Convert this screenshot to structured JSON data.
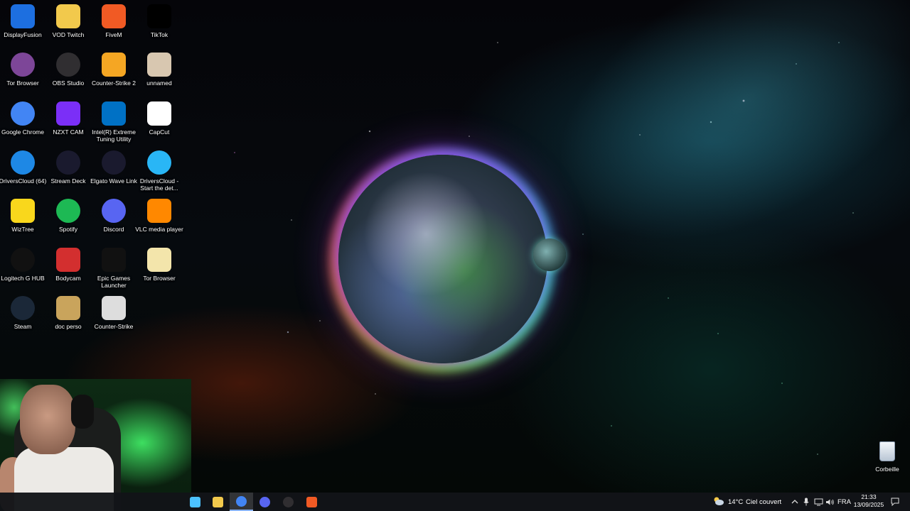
{
  "desktop": {
    "icons": [
      {
        "label": "DisplayFusion",
        "icon": "displayfusion-icon",
        "color": "#1d6fe0"
      },
      {
        "label": "VOD Twitch",
        "icon": "folder-icon",
        "color": "#f2c94c"
      },
      {
        "label": "FiveM",
        "icon": "fivem-icon",
        "color": "#f15a24"
      },
      {
        "label": "TikTok",
        "icon": "tiktok-icon",
        "color": "#000000"
      },
      {
        "label": "Tor Browser",
        "icon": "tor-browser-icon",
        "color": "#7d4698"
      },
      {
        "label": "OBS Studio",
        "icon": "obs-icon",
        "color": "#302e31"
      },
      {
        "label": "Counter-Strike 2",
        "icon": "counter-strike-2-icon",
        "color": "#f5a623"
      },
      {
        "label": "unnamed",
        "icon": "image-file-icon",
        "color": "#d8c7b0"
      },
      {
        "label": "Google Chrome",
        "icon": "chrome-icon",
        "color": "#4285f4"
      },
      {
        "label": "NZXT CAM",
        "icon": "nzxt-cam-icon",
        "color": "#7b2ff7"
      },
      {
        "label": "Intel(R) Extreme Tuning Utility",
        "icon": "intel-xtu-icon",
        "color": "#0071c5"
      },
      {
        "label": "CapCut",
        "icon": "capcut-icon",
        "color": "#ffffff"
      },
      {
        "label": "DriversCloud (64)",
        "icon": "driverscloud-icon",
        "color": "#1e88e5"
      },
      {
        "label": "Stream Deck",
        "icon": "stream-deck-icon",
        "color": "#1a1a2e"
      },
      {
        "label": "Elgato Wave Link",
        "icon": "wave-link-icon",
        "color": "#1a1a2e"
      },
      {
        "label": "DriversCloud - Start the det...",
        "icon": "driverscloud-shortcut-icon",
        "color": "#29b6f6"
      },
      {
        "label": "WizTree",
        "icon": "wiztree-icon",
        "color": "#f9d71c"
      },
      {
        "label": "Spotify",
        "icon": "spotify-icon",
        "color": "#1db954"
      },
      {
        "label": "Discord",
        "icon": "discord-icon",
        "color": "#5865f2"
      },
      {
        "label": "VLC media player",
        "icon": "vlc-icon",
        "color": "#ff8800"
      },
      {
        "label": "Logitech G HUB",
        "icon": "logitech-g-hub-icon",
        "color": "#111111"
      },
      {
        "label": "Bodycam",
        "icon": "bodycam-icon",
        "color": "#d32f2f"
      },
      {
        "label": "Epic Games Launcher",
        "icon": "epic-games-icon",
        "color": "#111111"
      },
      {
        "label": "Tor Browser",
        "icon": "tor-browser-file-icon",
        "color": "#f3e5ab"
      },
      {
        "label": "Steam",
        "icon": "steam-icon",
        "color": "#1b2838"
      },
      {
        "label": "doc perso",
        "icon": "archive-folder-icon",
        "color": "#c9a45c"
      },
      {
        "label": "Counter-Strike",
        "icon": "counter-strike-icon",
        "color": "#dddddd"
      }
    ],
    "recycle_bin": {
      "label": "Corbeille",
      "icon": "recycle-bin-icon"
    }
  },
  "taskbar": {
    "apps": [
      {
        "name": "windows-start-icon",
        "color": "#4cc2ff"
      },
      {
        "name": "file-explorer-icon",
        "color": "#f2c94c"
      },
      {
        "name": "chrome-icon",
        "color": "#4285f4"
      },
      {
        "name": "discord-icon",
        "color": "#5865f2"
      },
      {
        "name": "obs-icon",
        "color": "#302e31"
      },
      {
        "name": "fivem-icon",
        "color": "#f15a24"
      }
    ],
    "weather": {
      "temperature": "14°C",
      "condition": "Ciel couvert",
      "icon": "cloud-sun-icon"
    },
    "tray": {
      "chevron": "chevron-up-icon",
      "icons": [
        "microphone-icon",
        "network-icon",
        "volume-icon"
      ],
      "language": "FRA"
    },
    "clock": {
      "time": "21:33",
      "date": "13/09/2025"
    },
    "notifications_icon": "notifications-icon"
  }
}
